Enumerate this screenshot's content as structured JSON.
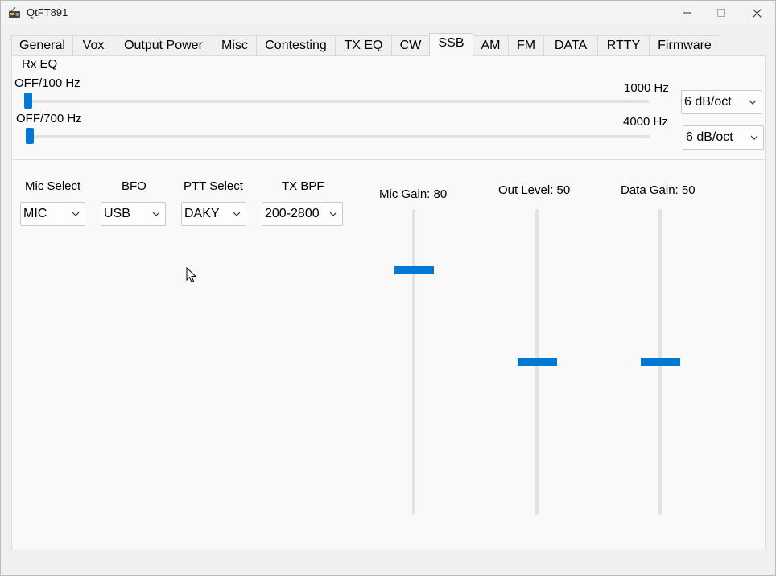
{
  "window": {
    "title": "QtFT891",
    "icon": "radio-icon",
    "controls": {
      "minimize": "minimize-icon",
      "maximize": "maximize-icon",
      "close": "close-icon"
    }
  },
  "tabs": [
    {
      "label": "General"
    },
    {
      "label": "Vox"
    },
    {
      "label": "Output Power"
    },
    {
      "label": "Misc"
    },
    {
      "label": "Contesting"
    },
    {
      "label": "TX EQ"
    },
    {
      "label": "CW"
    },
    {
      "label": "SSB",
      "active": true
    },
    {
      "label": "AM"
    },
    {
      "label": "FM"
    },
    {
      "label": "DATA"
    },
    {
      "label": "RTTY"
    },
    {
      "label": "Firmware"
    }
  ],
  "rx_eq": {
    "title": "Rx EQ",
    "low": {
      "start_label": "OFF/100 Hz",
      "end_label": "1000 Hz",
      "value_fraction": 0.0,
      "slope": "6 dB/oct"
    },
    "high": {
      "start_label": "OFF/700 Hz",
      "end_label": "4000 Hz",
      "value_fraction": 0.0,
      "slope": "6 dB/oct"
    }
  },
  "selects": {
    "mic_select": {
      "label": "Mic Select",
      "value": "MIC"
    },
    "bfo": {
      "label": "BFO",
      "value": "USB"
    },
    "ptt_select": {
      "label": "PTT Select",
      "value": "DAKY"
    },
    "tx_bpf": {
      "label": "TX BPF",
      "value": "200-2800"
    }
  },
  "gains": {
    "mic_gain": {
      "label": "Mic Gain: 80",
      "value": 80,
      "max": 100
    },
    "out_level": {
      "label": "Out Level: 50",
      "value": 50,
      "max": 100
    },
    "data_gain": {
      "label": "Data Gain: 50",
      "value": 50,
      "max": 100
    }
  },
  "colors": {
    "accent": "#0078d4",
    "track": "#e2e2e2",
    "panel": "#f9f9f9"
  }
}
